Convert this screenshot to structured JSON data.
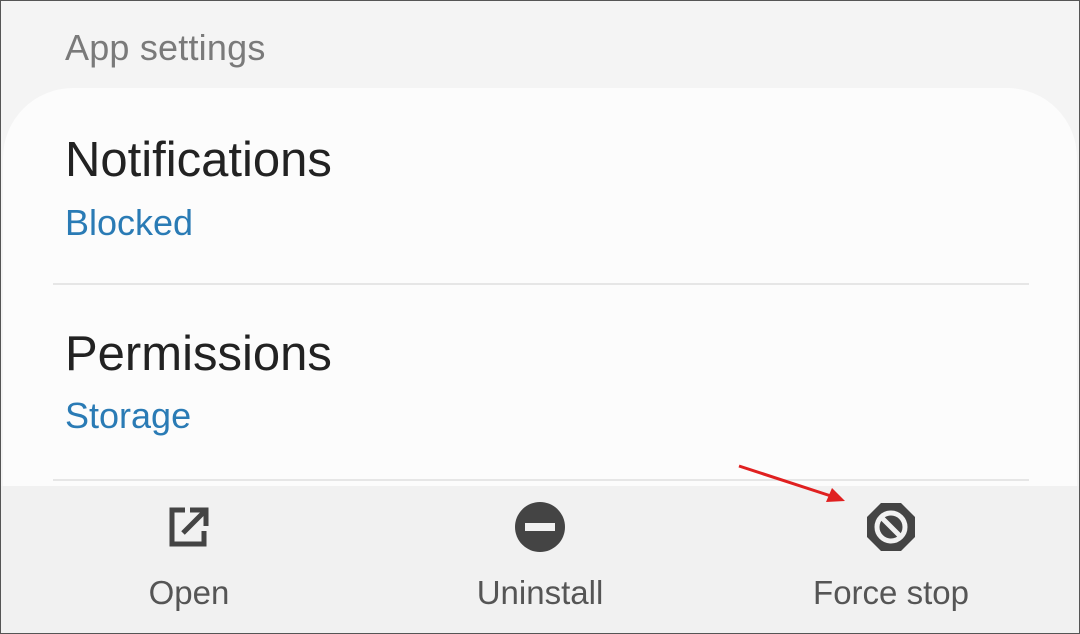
{
  "section_header": "App settings",
  "settings": {
    "notifications": {
      "title": "Notifications",
      "value": "Blocked"
    },
    "permissions": {
      "title": "Permissions",
      "value": "Storage"
    }
  },
  "actions": {
    "open": {
      "label": "Open",
      "icon": "open-external-icon"
    },
    "uninstall": {
      "label": "Uninstall",
      "icon": "minus-circle-icon"
    },
    "force_stop": {
      "label": "Force stop",
      "icon": "stop-octagon-icon"
    }
  },
  "colors": {
    "link_value": "#2a7bb5",
    "annotation_arrow": "#e02020",
    "icon": "#444444"
  }
}
